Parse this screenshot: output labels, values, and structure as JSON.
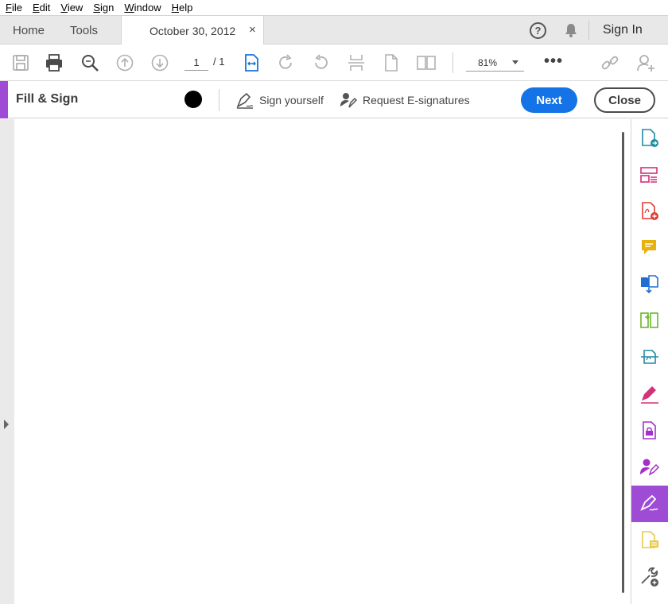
{
  "menu": {
    "items": [
      {
        "label": "File",
        "u": "F",
        "rest": "ile"
      },
      {
        "label": "Edit",
        "u": "E",
        "rest": "dit"
      },
      {
        "label": "View",
        "u": "V",
        "rest": "iew"
      },
      {
        "label": "Sign",
        "u": "S",
        "rest": "ign"
      },
      {
        "label": "Window",
        "u": "W",
        "rest": "indow"
      },
      {
        "label": "Help",
        "u": "H",
        "rest": "elp"
      }
    ]
  },
  "tabs": {
    "home": "Home",
    "tools": "Tools",
    "document": "October 30, 2012",
    "close_glyph": "×",
    "help_glyph": "?",
    "signin": "Sign In"
  },
  "toolbar": {
    "page_current": "1",
    "page_total": "/ 1",
    "zoom": "81%",
    "more_glyph": "•••"
  },
  "fill_sign": {
    "title": "Fill & Sign",
    "ink_color": "#000000",
    "sign_yourself": "Sign yourself",
    "request_esignatures": "Request E-signatures",
    "next": "Next",
    "close": "Close",
    "accent": "#9e4cd6",
    "next_color": "#1473e6"
  },
  "right_panel": {
    "active_tool": "fill-sign"
  }
}
